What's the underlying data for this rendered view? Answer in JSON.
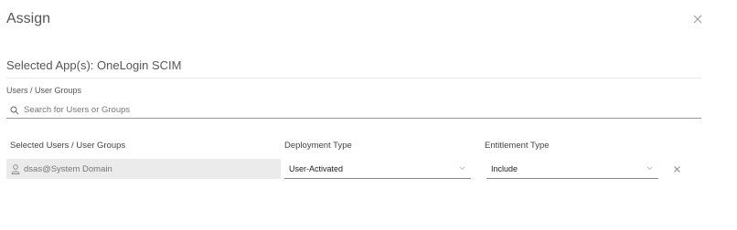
{
  "dialog": {
    "title": "Assign",
    "selected_app": "Selected App(s): OneLogin SCIM"
  },
  "search": {
    "label": "Users / User Groups",
    "placeholder": "Search for Users or Groups",
    "value": ""
  },
  "table": {
    "headers": {
      "users": "Selected Users / User Groups",
      "deployment": "Deployment Type",
      "entitlement": "Entitlement Type"
    },
    "rows": [
      {
        "user": "dsas@System Domain",
        "deployment_type": "User-Activated",
        "entitlement_type": "Include"
      }
    ]
  },
  "icons": {
    "close": "close-icon",
    "search": "search-icon",
    "user": "user-icon",
    "chevron": "chevron-down-icon",
    "remove": "close-icon"
  }
}
